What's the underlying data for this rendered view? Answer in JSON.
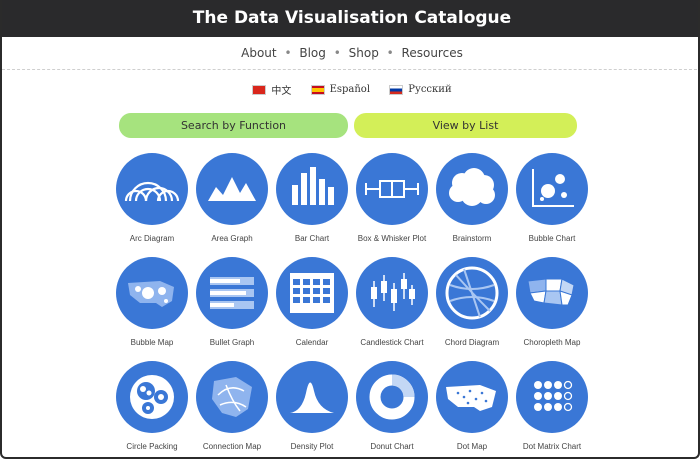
{
  "header": {
    "title": "The Data Visualisation Catalogue"
  },
  "nav": {
    "items": [
      {
        "label": "About"
      },
      {
        "label": "Blog"
      },
      {
        "label": "Shop"
      },
      {
        "label": "Resources"
      }
    ],
    "separator": "•"
  },
  "languages": [
    {
      "label": "中文",
      "flag": "china-flag-icon"
    },
    {
      "label": "Español",
      "flag": "spain-flag-icon"
    },
    {
      "label": "Русский",
      "flag": "russia-flag-icon"
    }
  ],
  "buttons": {
    "search_by_function": "Search by Function",
    "view_by_list": "View by List"
  },
  "colors": {
    "title_bar": "#2a2a2c",
    "icon_circle": "#3a77d6",
    "search_button": "#a6e37e",
    "list_button": "#d3ef58"
  },
  "catalogue": {
    "rows": [
      [
        {
          "label": "Arc Diagram",
          "icon": "arc-diagram-icon"
        },
        {
          "label": "Area Graph",
          "icon": "area-graph-icon"
        },
        {
          "label": "Bar Chart",
          "icon": "bar-chart-icon"
        },
        {
          "label": "Box & Whisker Plot",
          "icon": "box-whisker-icon"
        },
        {
          "label": "Brainstorm",
          "icon": "brainstorm-icon"
        },
        {
          "label": "Bubble Chart",
          "icon": "bubble-chart-icon"
        }
      ],
      [
        {
          "label": "Bubble Map",
          "icon": "bubble-map-icon"
        },
        {
          "label": "Bullet Graph",
          "icon": "bullet-graph-icon"
        },
        {
          "label": "Calendar",
          "icon": "calendar-icon"
        },
        {
          "label": "Candlestick Chart",
          "icon": "candlestick-icon"
        },
        {
          "label": "Chord Diagram",
          "icon": "chord-diagram-icon"
        },
        {
          "label": "Choropleth Map",
          "icon": "choropleth-map-icon"
        }
      ],
      [
        {
          "label": "Circle Packing",
          "icon": "circle-packing-icon"
        },
        {
          "label": "Connection Map",
          "icon": "connection-map-icon"
        },
        {
          "label": "Density Plot",
          "icon": "density-plot-icon"
        },
        {
          "label": "Donut Chart",
          "icon": "donut-chart-icon"
        },
        {
          "label": "Dot Map",
          "icon": "dot-map-icon"
        },
        {
          "label": "Dot Matrix Chart",
          "icon": "dot-matrix-icon"
        }
      ]
    ]
  }
}
